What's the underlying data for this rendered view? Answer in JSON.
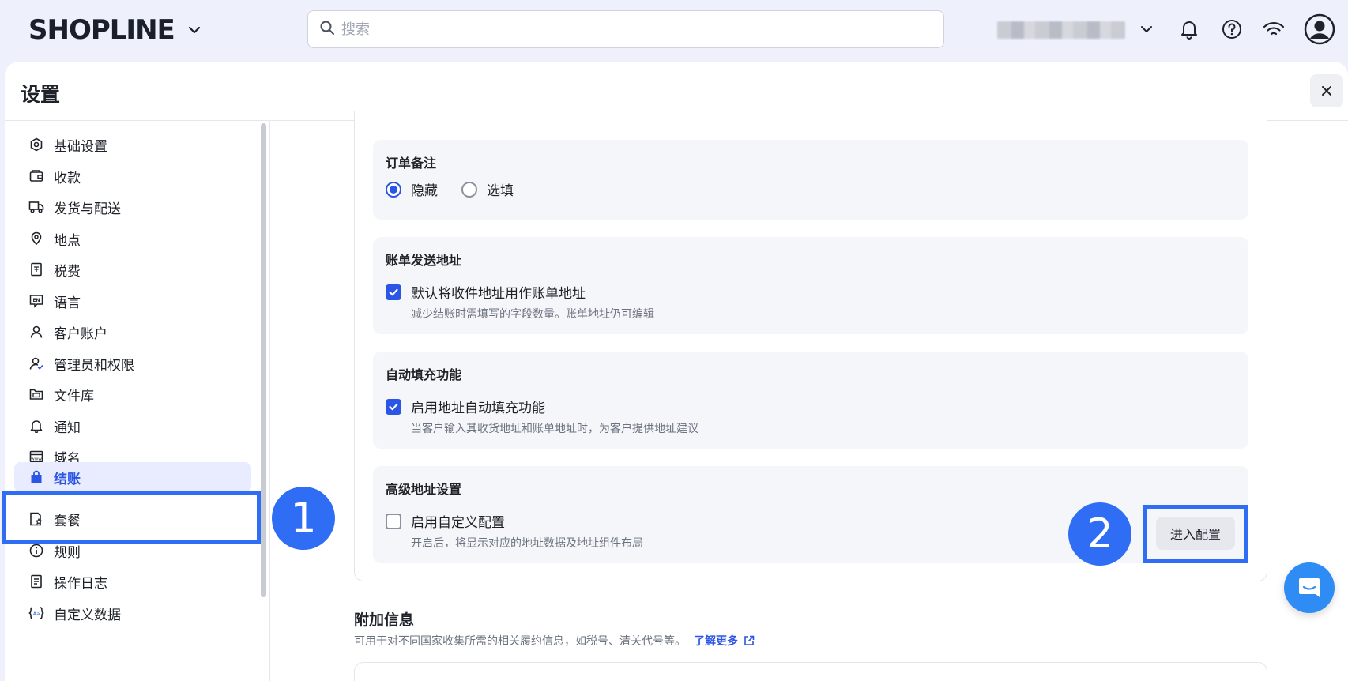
{
  "header": {
    "brand": "SHOPLINE",
    "search_placeholder": "搜索"
  },
  "page": {
    "title": "设置"
  },
  "sidebar": {
    "items": [
      {
        "label": "基础设置",
        "icon": "settings-hex-icon"
      },
      {
        "label": "收款",
        "icon": "wallet-icon"
      },
      {
        "label": "发货与配送",
        "icon": "truck-icon"
      },
      {
        "label": "地点",
        "icon": "location-pin-icon"
      },
      {
        "label": "税费",
        "icon": "receipt-icon"
      },
      {
        "label": "语言",
        "icon": "language-icon"
      },
      {
        "label": "客户账户",
        "icon": "user-icon"
      },
      {
        "label": "管理员和权限",
        "icon": "admin-user-icon"
      },
      {
        "label": "文件库",
        "icon": "folder-icon"
      },
      {
        "label": "通知",
        "icon": "bell-icon"
      },
      {
        "label": "域名",
        "icon": "domain-icon"
      },
      {
        "label": "结账",
        "icon": "shopping-bag-icon",
        "active": true
      },
      {
        "label": "套餐",
        "icon": "plan-icon"
      },
      {
        "label": "规则",
        "icon": "info-icon"
      },
      {
        "label": "操作日志",
        "icon": "log-icon"
      },
      {
        "label": "自定义数据",
        "icon": "custom-data-icon"
      }
    ]
  },
  "sections": {
    "order_note": {
      "title": "订单备注",
      "options": [
        {
          "label": "隐藏",
          "selected": true
        },
        {
          "label": "选填",
          "selected": false
        }
      ]
    },
    "billing_address": {
      "title": "账单发送地址",
      "checkbox_label": "默认将收件地址用作账单地址",
      "checked": true,
      "hint": "减少结账时需填写的字段数量。账单地址仍可编辑"
    },
    "autofill": {
      "title": "自动填充功能",
      "checkbox_label": "启用地址自动填充功能",
      "checked": true,
      "hint": "当客户输入其收货地址和账单地址时，为客户提供地址建议"
    },
    "advanced_address": {
      "title": "高级地址设置",
      "checkbox_label": "启用自定义配置",
      "checked": false,
      "hint": "开启后，将显示对应的地址数据及地址组件布局",
      "button_label": "进入配置"
    }
  },
  "additional_info": {
    "title": "附加信息",
    "description": "可用于对不同国家收集所需的相关履约信息，如税号、清关代号等。",
    "link_label": "了解更多"
  },
  "annotations": {
    "step1": "1",
    "step2": "2"
  },
  "colors": {
    "accent": "#2a55e5",
    "annotation": "#2f6df5"
  }
}
